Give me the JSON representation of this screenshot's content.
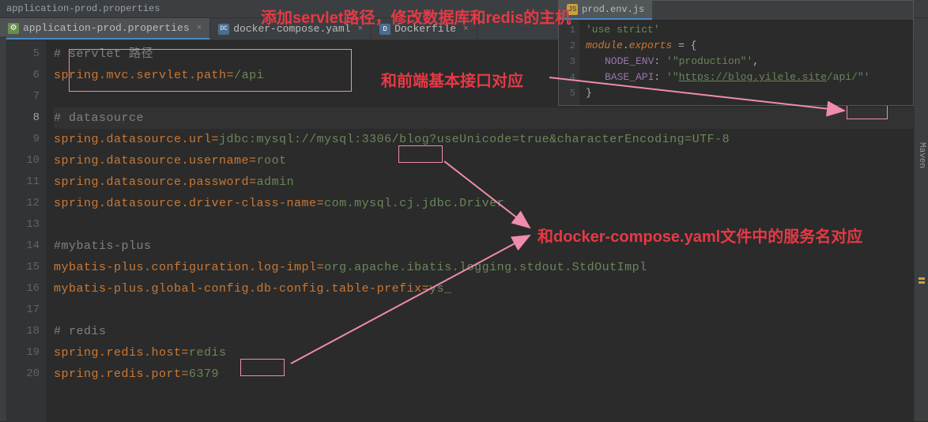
{
  "breadcrumb": "application-prod.properties",
  "tabs": [
    {
      "label": "application-prod.properties",
      "iconClass": "icon-props",
      "iconText": "⚙"
    },
    {
      "label": "docker-compose.yaml",
      "iconClass": "icon-yaml",
      "iconText": "DC"
    },
    {
      "label": "Dockerfile",
      "iconClass": "icon-docker",
      "iconText": "D"
    }
  ],
  "sideTab": {
    "label": "prod.env.js",
    "iconClass": "icon-js",
    "iconText": "JS"
  },
  "lines": {
    "l5": {
      "num": "5",
      "comment": "# servlet 路径"
    },
    "l6": {
      "num": "6",
      "key": "spring.mvc.servlet.path",
      "value": "/api"
    },
    "l7": {
      "num": "7"
    },
    "l8": {
      "num": "8",
      "comment": "# datasource"
    },
    "l9": {
      "num": "9",
      "key": "spring.datasource.url",
      "valuePrefix": "jdbc:mysql://",
      "valueBox": "mysql",
      "valueSuffix": ":3306/blog?useUnicode=true&characterEncoding=UTF-8"
    },
    "l10": {
      "num": "10",
      "key": "spring.datasource.username",
      "value": "root"
    },
    "l11": {
      "num": "11",
      "key": "spring.datasource.password",
      "value": "admin"
    },
    "l12": {
      "num": "12",
      "key": "spring.datasource.driver-class-name",
      "value": "com.mysql.cj.jdbc.Driver"
    },
    "l13": {
      "num": "13"
    },
    "l14": {
      "num": "14",
      "comment": "#mybatis-plus"
    },
    "l15": {
      "num": "15",
      "key": "mybatis-plus.configuration.log-impl",
      "value": "org.apache.ibatis.logging.stdout.StdOutImpl"
    },
    "l16": {
      "num": "16",
      "key": "mybatis-plus.global-config.db-config.table-prefix",
      "value": "ys_"
    },
    "l17": {
      "num": "17"
    },
    "l18": {
      "num": "18",
      "comment": "# redis"
    },
    "l19": {
      "num": "19",
      "key": "spring.redis.host",
      "valueBox": "redis"
    },
    "l20": {
      "num": "20",
      "key": "spring.redis.port",
      "value": "6379"
    }
  },
  "sideLines": {
    "s1": {
      "num": "1",
      "text": "'use strict'"
    },
    "s2": {
      "num": "2",
      "kw1": "module",
      "punct1": ".",
      "kw2": "exports",
      "punct2": " = {"
    },
    "s3": {
      "num": "3",
      "prop": "NODE_ENV",
      "val": "'\"production\"'",
      "sep": ": ",
      "end": ","
    },
    "s4": {
      "num": "4",
      "prop": "BASE_API",
      "sep": ": ",
      "val1": "'\"",
      "url": "https://blog.yilele.site",
      "val2": "/api/\"'"
    },
    "s5": {
      "num": "5",
      "text": "}"
    }
  },
  "annotations": {
    "top": "添加servlet路径，修改数据库和redis的主机",
    "mid1": "和前端基本接口对应",
    "mid2": "和docker-compose.yaml文件中的服务名对应"
  },
  "mavenLabel": "Maven"
}
